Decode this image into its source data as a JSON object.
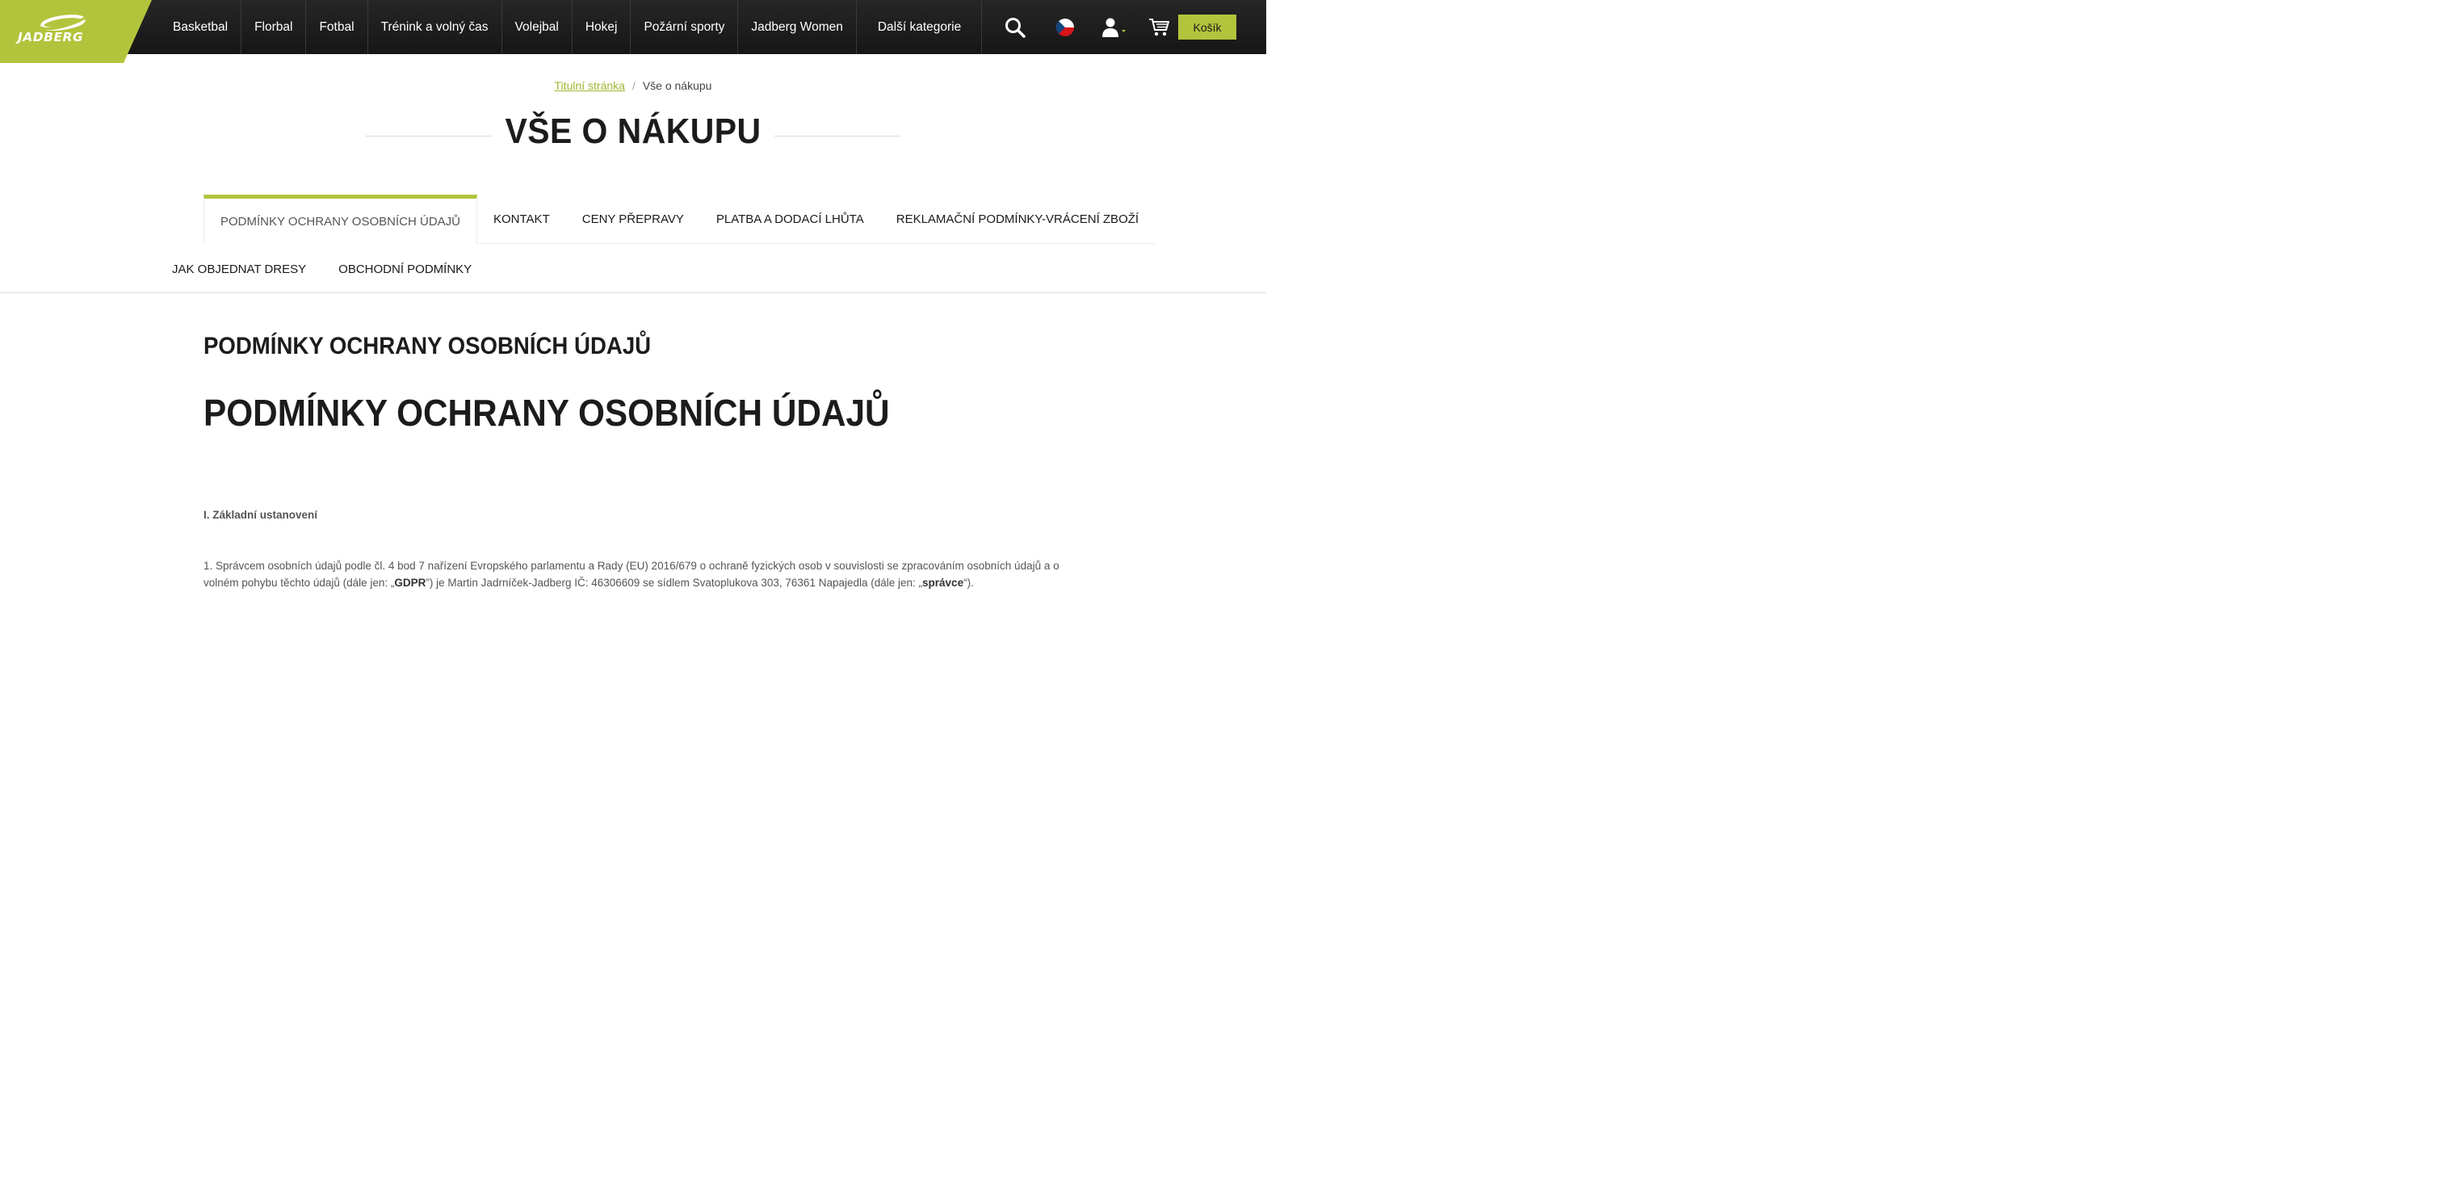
{
  "header": {
    "logo_text": "JADBERG",
    "nav": [
      "Basketbal",
      "Florbal",
      "Fotbal",
      "Trénink a volný čas",
      "Volejbal",
      "Hokej",
      "Požární sporty",
      "Jadberg Women",
      "Další kategorie"
    ],
    "cart_label": "Košík",
    "icons": [
      "search-icon",
      "czech-flag-icon",
      "user-icon",
      "cart-icon"
    ]
  },
  "breadcrumb": {
    "home": "Titulní stránka",
    "separator": "/",
    "current": "Vše o nákupu"
  },
  "page_title": "VŠE O NÁKUPU",
  "tabs": {
    "row1": [
      "PODMÍNKY OCHRANY OSOBNÍCH ÚDAJŮ",
      "KONTAKT",
      "CENY PŘEPRAVY",
      "PLATBA A DODACÍ LHŮTA",
      "REKLAMAČNÍ PODMÍNKY-VRÁCENÍ ZBOŽÍ"
    ],
    "row2": [
      "JAK OBJEDNAT DRESY",
      "OBCHODNÍ PODMÍNKY"
    ],
    "active": "PODMÍNKY OCHRANY OSOBNÍCH ÚDAJŮ"
  },
  "content": {
    "heading_small": "PODMÍNKY OCHRANY OSOBNÍCH ÚDAJŮ",
    "heading_large": "PODMÍNKY OCHRANY OSOBNÍCH ÚDAJŮ",
    "section_title": "I. Základní ustanovení",
    "paragraph": {
      "part1": "1. Správcem osobních údajů podle čl. 4 bod 7 nařízení Evropského parlamentu a Rady (EU) 2016/679 o ochraně fyzických osob v souvislosti se zpracováním osobních údajů a o volném pohybu těchto údajů (dále jen: „",
      "bold1": "GDPR",
      "part2": "”) je Martin Jadrníček-Jadberg IČ: 46306609 se sídlem Svatoplukova 303, 76361 Napajedla (dále jen: „",
      "bold2": "správce",
      "part3": "“)."
    }
  },
  "colors": {
    "accent": "#b2c43c",
    "header_bg": "#1e1e1e",
    "link": "#a2b52f"
  }
}
